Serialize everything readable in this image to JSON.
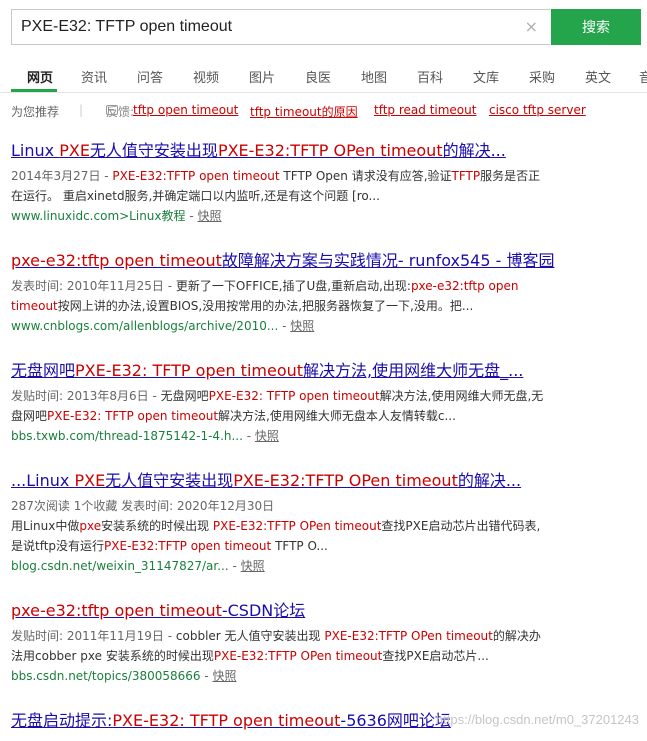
{
  "search": {
    "query": "PXE-E32: TFTP open timeout",
    "button_label": "搜索",
    "clear_icon": "×"
  },
  "nav": {
    "tabs": [
      "网页",
      "资讯",
      "问答",
      "视频",
      "图片",
      "良医",
      "地图",
      "百科",
      "文库",
      "采购",
      "英文",
      "音"
    ],
    "active": "网页"
  },
  "recommend": {
    "label": "为您推荐",
    "feedback": "反馈:",
    "links": [
      "tftp open timeout",
      "tftp timeout的原因",
      "tftp read timeout",
      "cisco tftp server"
    ]
  },
  "results": [
    {
      "title": [
        {
          "t": "Linux ",
          "h": false
        },
        {
          "t": "PXE",
          "h": true
        },
        {
          "t": "无人值守安装出现",
          "h": false
        },
        {
          "t": "PXE-E32:TFTP OPen timeout",
          "h": true
        },
        {
          "t": "的解决...",
          "h": false
        }
      ],
      "body": [
        {
          "t": "2014年3月27日 - ",
          "m": true
        },
        {
          "t": "PXE-E32:TFTP open timeout",
          "h": true
        },
        {
          "t": " TFTP Open 请求没有应答,验证"
        },
        {
          "t": "TFTP",
          "h": true
        },
        {
          "t": "服务是否正在运行。 重启xinetd服务,并确定端口以内监听,还是有这个问题 [ro..."
        }
      ],
      "url": "www.linuxidc.com>Linux教程",
      "snapshot": "快照"
    },
    {
      "title": [
        {
          "t": "pxe-e32:tftp open timeout",
          "h": true
        },
        {
          "t": "故障解决方案与实践情况- runfox545 - 博客园",
          "h": false
        }
      ],
      "body": [
        {
          "t": "发表时间:  2010年11月25日 - ",
          "m": true
        },
        {
          "t": "更新了一下OFFICE,插了U盘,重新启动,出现:"
        },
        {
          "t": "pxe-e32:tftp open timeout",
          "h": true
        },
        {
          "t": "按网上讲的办法,设置BIOS,没用按常用的办法,把服务器恢复了一下,没用。把..."
        }
      ],
      "url": "www.cnblogs.com/allenblogs/archive/2010...",
      "snapshot": "快照"
    },
    {
      "title": [
        {
          "t": "无盘网吧",
          "h": false
        },
        {
          "t": "PXE-E32: TFTP open timeout",
          "h": true
        },
        {
          "t": "解决方法,使用网维大师无盘_...",
          "h": false
        }
      ],
      "body": [
        {
          "t": "发贴时间:  2013年8月6日 - ",
          "m": true
        },
        {
          "t": "无盘网吧"
        },
        {
          "t": "PXE-E32: TFTP open timeout",
          "h": true
        },
        {
          "t": "解决方法,使用网维大师无盘,无盘网吧"
        },
        {
          "t": "PXE-E32: TFTP open timeout",
          "h": true
        },
        {
          "t": "解决方法,使用网维大师无盘本人友情转载c..."
        }
      ],
      "url": "bbs.txwb.com/thread-1875142-1-4.h...",
      "snapshot": "快照"
    },
    {
      "title": [
        {
          "t": "...Linux ",
          "h": false
        },
        {
          "t": "PXE",
          "h": true
        },
        {
          "t": "无人值守安装出现",
          "h": false
        },
        {
          "t": "PXE-E32:TFTP OPen timeout",
          "h": true
        },
        {
          "t": "的解决...",
          "h": false
        }
      ],
      "meta": "287次阅读  1个收藏  发表时间: 2020年12月30日",
      "body": [
        {
          "t": "用Linux中做"
        },
        {
          "t": "pxe",
          "h": true
        },
        {
          "t": "安装系统的时候出现 "
        },
        {
          "t": "PXE-E32:TFTP OPen timeout",
          "h": true
        },
        {
          "t": "查找PXE启动芯片出错代码表,是说tftp没有运行"
        },
        {
          "t": "PXE-E32:TFTP open timeout",
          "h": true
        },
        {
          "t": " TFTP O..."
        }
      ],
      "url": "blog.csdn.net/weixin_31147827/ar...",
      "snapshot": "快照"
    },
    {
      "title": [
        {
          "t": "pxe-e32:tftp open timeout",
          "h": true
        },
        {
          "t": "-CSDN论坛",
          "h": false
        }
      ],
      "body": [
        {
          "t": "发贴时间:  2011年11月19日 - ",
          "m": true
        },
        {
          "t": "cobbler 无人值守安装出现 "
        },
        {
          "t": "PXE-E32:TFTP OPen timeout",
          "h": true
        },
        {
          "t": "的解决办法用cobber pxe 安装系统的时候出现"
        },
        {
          "t": "PXE-E32:TFTP OPen timeout",
          "h": true
        },
        {
          "t": "查找PXE启动芯片..."
        }
      ],
      "url": "bbs.csdn.net/topics/380058666",
      "snapshot": "快照"
    },
    {
      "title": [
        {
          "t": "无盘启动提示:",
          "h": false
        },
        {
          "t": "PXE-E32: TFTP open timeout",
          "h": true
        },
        {
          "t": "-5636网吧论坛",
          "h": false
        }
      ]
    }
  ],
  "watermark": "https://blog.csdn.net/m0_37201243",
  "colors": {
    "accent": "#25a54b",
    "highlight": "#cc0000",
    "link": "#1a0dab",
    "url": "#1a7f3c"
  }
}
